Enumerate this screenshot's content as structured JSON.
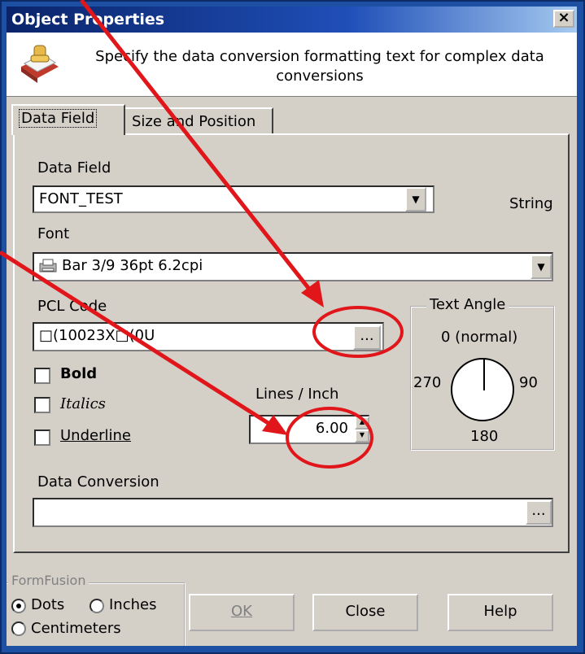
{
  "window": {
    "title": "Object Properties",
    "close_glyph": "×"
  },
  "header": {
    "text": "Specify the data conversion formatting text for complex data conversions",
    "icon": "wizard-hand-icon"
  },
  "tabs": [
    {
      "label": "Data Field",
      "active": true
    },
    {
      "label": "Size and Position",
      "active": false
    }
  ],
  "data_field": {
    "label": "Data Field",
    "value": "FONT_TEST",
    "type": "String"
  },
  "font": {
    "label": "Font",
    "value": "Bar 3/9 36pt 6.2cpi",
    "icon": "printer-font-icon"
  },
  "pcl_code": {
    "label": "PCL Code",
    "value": "□(10023X□(0U",
    "browse_label": "..."
  },
  "styles": [
    {
      "label": "Bold",
      "checked": false
    },
    {
      "label": "Italics",
      "checked": false
    },
    {
      "label": "Underline",
      "checked": false
    }
  ],
  "lines_per_inch": {
    "label": "Lines / Inch",
    "value": "6.00"
  },
  "text_angle": {
    "title": "Text Angle",
    "top_label": "0 (normal)",
    "left_label": "270",
    "right_label": "90",
    "bottom_label": "180"
  },
  "data_conversion": {
    "label": "Data Conversion",
    "value": "",
    "browse_label": "..."
  },
  "units": {
    "group_title": "FormFusion",
    "options": [
      {
        "label": "Dots",
        "selected": true
      },
      {
        "label": "Inches",
        "selected": false
      },
      {
        "label": "Centimeters",
        "selected": false
      }
    ]
  },
  "buttons": {
    "ok": "OK",
    "close": "Close",
    "help": "Help"
  },
  "colors": {
    "annotation": "#e0161a",
    "title_bar": "#0a246a",
    "dialog_face": "#d4d0c8"
  }
}
